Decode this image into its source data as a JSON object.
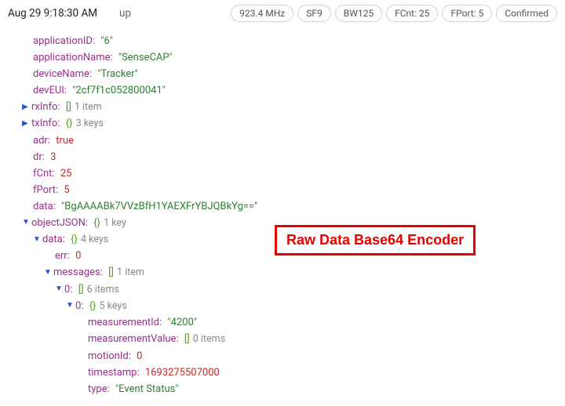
{
  "header": {
    "timestamp": "Aug 29 9:18:30 AM",
    "direction": "up",
    "pills": {
      "freq": "923.4 MHz",
      "sf": "SF9",
      "bw": "BW125",
      "fcnt": "FCnt: 25",
      "fport": "FPort: 5",
      "confirmed": "Confirmed"
    }
  },
  "payload": {
    "applicationID_key": "applicationID",
    "applicationID": "\"6\"",
    "applicationName_key": "applicationName",
    "applicationName": "\"SenseCAP\"",
    "deviceName_key": "deviceName",
    "deviceName": "\"Tracker\"",
    "devEUI_key": "devEUI",
    "devEUI": "\"2cf7f1c052800041\"",
    "rxInfo_key": "rxInfo",
    "rxInfo_meta": "1 item",
    "txInfo_key": "txInfo",
    "txInfo_meta": "3 keys",
    "adr_key": "adr",
    "adr": "true",
    "dr_key": "dr",
    "dr": "3",
    "fCnt_key": "fCnt",
    "fCnt": "25",
    "fPort_key": "fPort",
    "fPort": "5",
    "data_key": "data",
    "data": "\"BgAAAABk7VVzBfH1YAEXFrYBJQBkYg==\"",
    "objectJSON_key": "objectJSON",
    "objectJSON_meta": "1 key",
    "oj": {
      "data_key": "data",
      "data_meta": "4 keys",
      "err_key": "err",
      "err": "0",
      "messages_key": "messages",
      "messages_meta": "1 item",
      "m0_key": "0",
      "m0_meta": "6 items",
      "m00_key": "0",
      "m00_meta": "5 keys",
      "measurementId_key": "measurementId",
      "measurementId": "\"4200\"",
      "measurementValue_key": "measurementValue",
      "measurementValue_meta": "0 items",
      "motionId_key": "motionId",
      "motionId": "0",
      "timestamp_key": "timestamp",
      "timestamp": "1693275507000",
      "type_key": "type",
      "type": "\"Event Status\""
    }
  },
  "callout": "Raw Data Base64 Encoder"
}
